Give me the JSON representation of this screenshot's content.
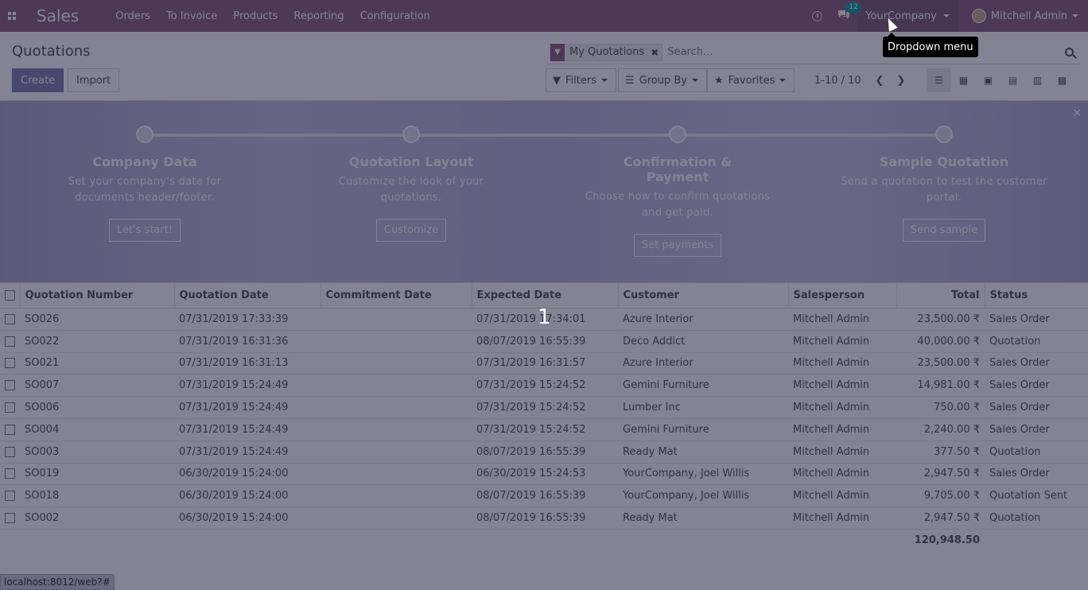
{
  "nav": {
    "brand": "Sales",
    "menu": [
      "Orders",
      "To Invoice",
      "Products",
      "Reporting",
      "Configuration"
    ],
    "chat_badge": "12",
    "company": "YourCompany",
    "user": "Mitchell Admin",
    "accent": "#875a7b"
  },
  "control": {
    "breadcrumb": "Quotations",
    "create_label": "Create",
    "import_label": "Import",
    "facet_label": "My Quotations",
    "search_placeholder": "Search...",
    "filters_label": "Filters",
    "groupby_label": "Group By",
    "favorites_label": "Favorites",
    "pager": "1-10 / 10",
    "views": [
      "list-view-icon",
      "kanban-view-icon",
      "calendar-view-icon",
      "pivot-view-icon",
      "graph-view-icon",
      "activity-view-icon"
    ]
  },
  "onboarding": {
    "steps": [
      {
        "title": "Company Data",
        "desc": "Set your company's data for documents header/footer.",
        "button": "Let's start!"
      },
      {
        "title": "Quotation Layout",
        "desc": "Customize the look of your quotations.",
        "button": "Customize"
      },
      {
        "title": "Confirmation & Payment",
        "desc": "Choose how to confirm quotations and get paid.",
        "button": "Set payments"
      },
      {
        "title": "Sample Quotation",
        "desc": "Send a quotation to test the customer portal.",
        "button": "Send sample"
      }
    ]
  },
  "table": {
    "headers": [
      "Quotation Number",
      "Quotation Date",
      "Commitment Date",
      "Expected Date",
      "Customer",
      "Salesperson",
      "Total",
      "Status"
    ],
    "rows": [
      [
        "SO026",
        "07/31/2019 17:33:39",
        "",
        "07/31/2019 17:34:01",
        "Azure Interior",
        "Mitchell Admin",
        "23,500.00 ₹",
        "Sales Order"
      ],
      [
        "SO022",
        "07/31/2019 16:31:36",
        "",
        "08/07/2019 16:55:39",
        "Deco Addict",
        "Mitchell Admin",
        "40,000.00 ₹",
        "Quotation"
      ],
      [
        "SO021",
        "07/31/2019 16:31:13",
        "",
        "07/31/2019 16:31:57",
        "Azure Interior",
        "Mitchell Admin",
        "23,500.00 ₹",
        "Sales Order"
      ],
      [
        "SO007",
        "07/31/2019 15:24:49",
        "",
        "07/31/2019 15:24:52",
        "Gemini Furniture",
        "Mitchell Admin",
        "14,981.00 ₹",
        "Sales Order"
      ],
      [
        "SO006",
        "07/31/2019 15:24:49",
        "",
        "07/31/2019 15:24:52",
        "Lumber Inc",
        "Mitchell Admin",
        "750.00 ₹",
        "Sales Order"
      ],
      [
        "SO004",
        "07/31/2019 15:24:49",
        "",
        "07/31/2019 15:24:52",
        "Gemini Furniture",
        "Mitchell Admin",
        "2,240.00 ₹",
        "Sales Order"
      ],
      [
        "SO003",
        "07/31/2019 15:24:49",
        "",
        "08/07/2019 16:55:39",
        "Ready Mat",
        "Mitchell Admin",
        "377.50 ₹",
        "Quotation"
      ],
      [
        "SO019",
        "06/30/2019 15:24:00",
        "",
        "06/30/2019 15:24:53",
        "YourCompany, Joel Willis",
        "Mitchell Admin",
        "2,947.50 ₹",
        "Sales Order"
      ],
      [
        "SO018",
        "06/30/2019 15:24:00",
        "",
        "08/07/2019 16:55:39",
        "YourCompany, Joel Willis",
        "Mitchell Admin",
        "9,705.00 ₹",
        "Quotation Sent"
      ],
      [
        "SO002",
        "06/30/2019 15:24:00",
        "",
        "08/07/2019 16:55:39",
        "Ready Mat",
        "Mitchell Admin",
        "2,947.50 ₹",
        "Quotation"
      ]
    ],
    "grand_total": "120,948.50"
  },
  "tooltip": "Dropdown menu",
  "step_marker": "1",
  "statusbar": "localhost:8012/web?#"
}
